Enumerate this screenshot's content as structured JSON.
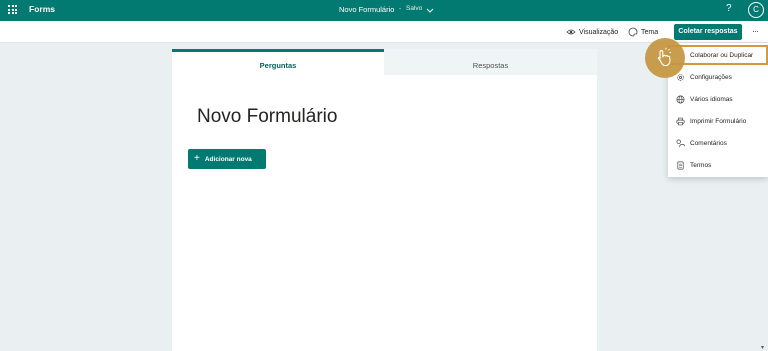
{
  "topbar": {
    "app_name": "Forms",
    "doc_title": "Novo Formulário",
    "separator": "-",
    "status": "Salvo",
    "help": "?",
    "avatar_initial": "C"
  },
  "toolbar": {
    "preview_label": "Visualização",
    "theme_label": "Tema",
    "collect_label": "Coletar respostas",
    "more": "···"
  },
  "tabs": [
    {
      "label": "Perguntas",
      "active": true
    },
    {
      "label": "Respostas",
      "active": false
    }
  ],
  "form": {
    "title": "Novo Formulário",
    "add_new_label": "Adicionar nova"
  },
  "menu": {
    "items": [
      {
        "label": "Colaborar ou Duplicar",
        "icon": "collaborate-icon"
      },
      {
        "label": "Configurações",
        "icon": "gear-icon"
      },
      {
        "label": "Vários idiomas",
        "icon": "globe-icon"
      },
      {
        "label": "Imprimir Formulário",
        "icon": "print-icon"
      },
      {
        "label": "Comentários",
        "icon": "comments-icon"
      },
      {
        "label": "Termos",
        "icon": "document-icon"
      }
    ]
  },
  "colors": {
    "brand": "#037a71",
    "highlight": "#d39a3b"
  }
}
